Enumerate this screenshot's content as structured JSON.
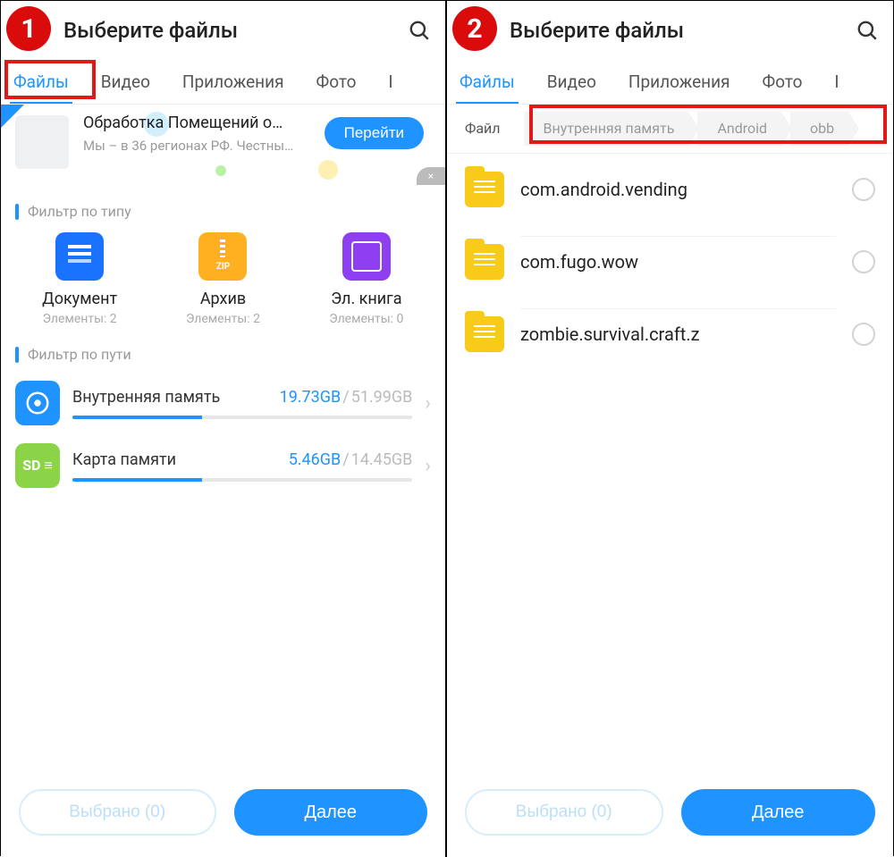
{
  "left": {
    "step": "1",
    "header_title": "Выберите файлы",
    "tabs": [
      "Файлы",
      "Видео",
      "Приложения",
      "Фото"
    ],
    "tab_cut": "I",
    "active_tab_index": 0,
    "ad": {
      "title": "Обработка Помещений о…",
      "subtitle": "Мы – в 36 регионах РФ. Честны…",
      "button": "Перейти",
      "close": "×"
    },
    "section_type": "Фильтр по типу",
    "types": [
      {
        "name": "Документ",
        "count": "Элементы: 2"
      },
      {
        "name": "Архив",
        "count": "Элементы: 2"
      },
      {
        "name": "Эл. книга",
        "count": "Элементы: 0"
      }
    ],
    "section_path": "Фильтр по пути",
    "storages": [
      {
        "name": "Внутренняя память",
        "used": "19.73GB",
        "total": "51.99GB",
        "percent": 38
      },
      {
        "name": "Карта памяти",
        "used": "5.46GB",
        "total": "14.45GB",
        "percent": 38
      }
    ],
    "footer": {
      "selected": "Выбрано (0)",
      "next": "Далее"
    }
  },
  "right": {
    "step": "2",
    "header_title": "Выберите файлы",
    "tabs": [
      "Файлы",
      "Видео",
      "Приложения",
      "Фото"
    ],
    "tab_cut": "I",
    "active_tab_index": 0,
    "breadcrumb": [
      "Файл",
      "Внутренняя память",
      "Android",
      "obb"
    ],
    "folders": [
      "com.android.vending",
      "com.fugo.wow",
      "zombie.survival.craft.z"
    ],
    "footer": {
      "selected": "Выбрано (0)",
      "next": "Далее"
    }
  }
}
